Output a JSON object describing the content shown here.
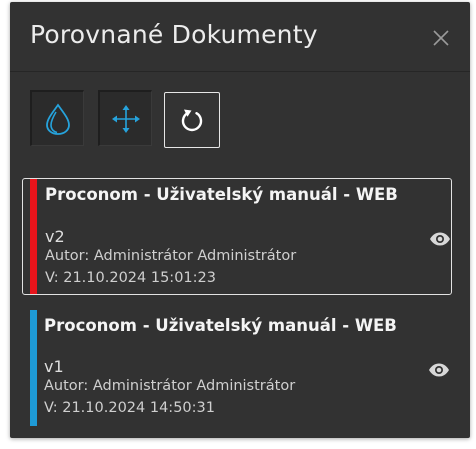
{
  "window": {
    "title": "Porovnané Dokumenty"
  },
  "toolbar": {
    "buttons": [
      {
        "name": "overlay-mode",
        "icon": "drops-icon",
        "color": "#26a3dc"
      },
      {
        "name": "move-mode",
        "icon": "move-arrows-icon",
        "color": "#26a3dc"
      },
      {
        "name": "reset",
        "icon": "refresh-icon",
        "color": "#ffffff"
      }
    ]
  },
  "documents": [
    {
      "title": "Proconom - Uživatelský manuál - WEB",
      "version": "v2",
      "author": "Autor: Administrátor Administrátor",
      "date": "V: 21.10.2024 15:01:23",
      "color": "#e8141b",
      "selected": true
    },
    {
      "title": "Proconom - Uživatelský manuál - WEB",
      "version": "v1",
      "author": "Autor: Administrátor Administrátor",
      "date": "V: 21.10.2024 14:50:31",
      "color": "#1e9ad6",
      "selected": false
    }
  ]
}
